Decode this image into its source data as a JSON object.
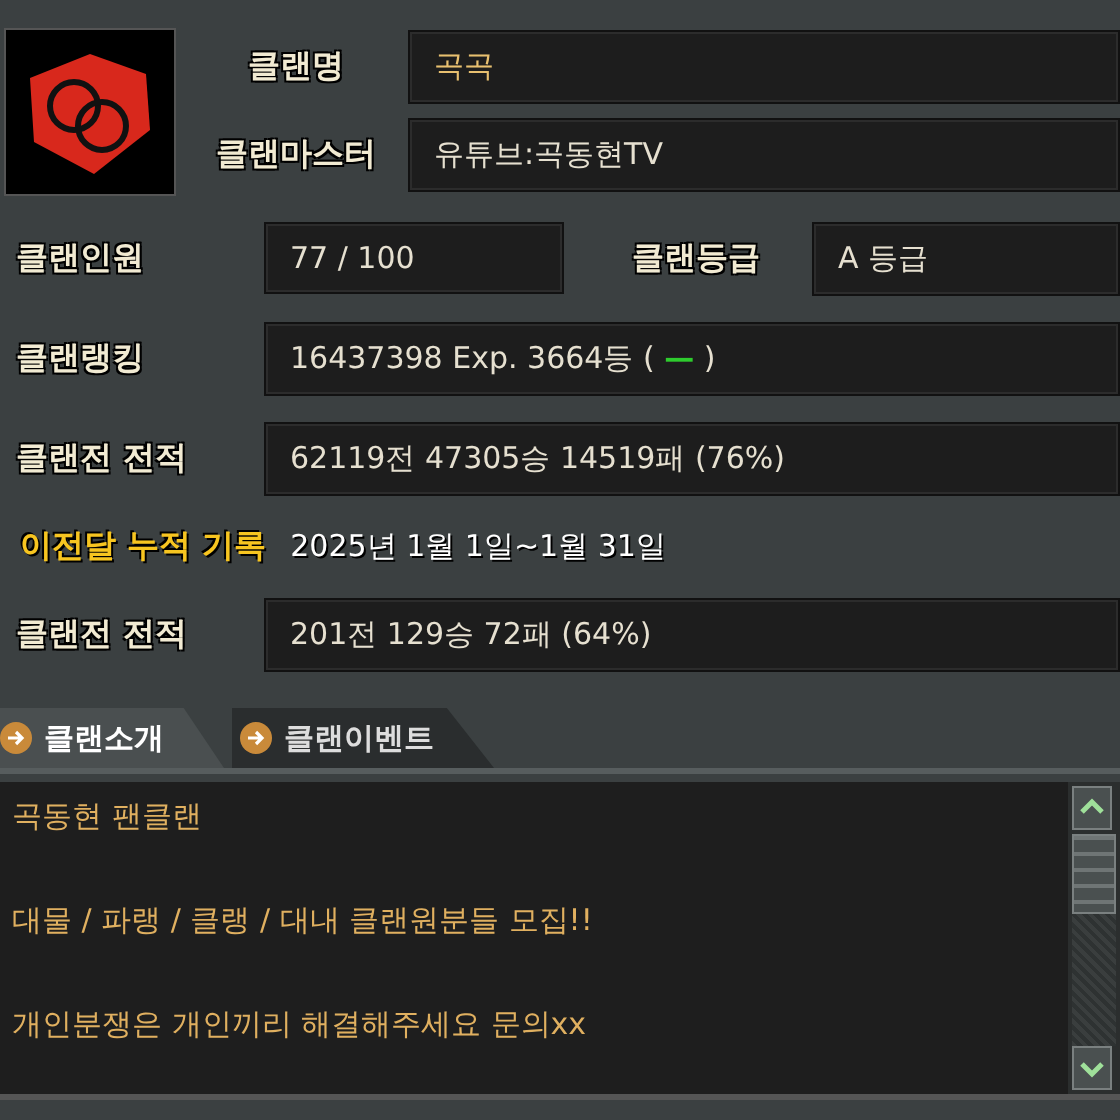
{
  "clan_name": {
    "label": "클랜명",
    "value": "곡곡"
  },
  "clan_master": {
    "label": "클랜마스터",
    "value": "유튜브:곡동현TV"
  },
  "members": {
    "label": "클랜인원",
    "value": "77 / 100"
  },
  "grade": {
    "label": "클랜등급",
    "value": "A 등급"
  },
  "ranking": {
    "label": "클랜랭킹",
    "value": "16437398 Exp.  3664등 (",
    "trend": "—",
    "value_end": ")"
  },
  "record": {
    "label": "클랜전 전적",
    "value": "62119전 47305승 14519패 (76%)"
  },
  "last_month": {
    "label": "이전달 누적 기록",
    "period": "2025년 1월 1일~1월 31일"
  },
  "last_month_record": {
    "label": "클랜전 전적",
    "value": "201전 129승 72패 (64%)"
  },
  "tabs": [
    {
      "label": "클랜소개",
      "selected": true
    },
    {
      "label": "클랜이벤트",
      "selected": false
    }
  ],
  "intro_lines": [
    "곡동현 팬클랜",
    "대물 / 파랭 / 클랭 / 대내 클랜원분들 모집!!",
    "개인분쟁은 개인끼리 해결해주세요 문의xx"
  ]
}
